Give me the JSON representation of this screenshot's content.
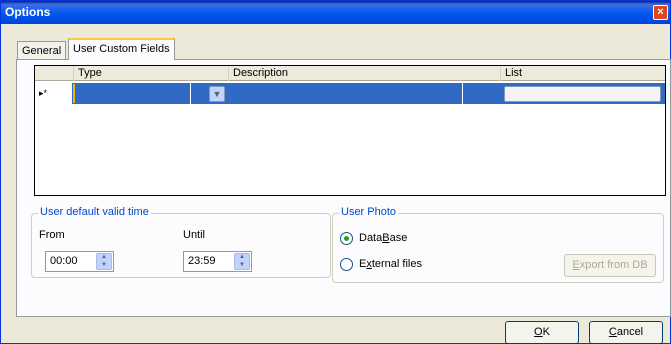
{
  "window": {
    "title": "Options",
    "close_glyph": "×"
  },
  "tabs": [
    {
      "label": "General",
      "active": false
    },
    {
      "label": "User Custom Fields",
      "active": true
    }
  ],
  "grid": {
    "columns": [
      "Type",
      "Description",
      "List"
    ],
    "row_indicator": "▸*",
    "rows": [
      {
        "type": "",
        "description": "",
        "list": ""
      }
    ]
  },
  "valid_time": {
    "title": "User default valid time",
    "from_label": "From",
    "until_label": "Until",
    "from_value": "00:00",
    "until_value": "23:59"
  },
  "photo": {
    "title": "User Photo",
    "options": [
      {
        "label_pre": "Data",
        "label_u": "B",
        "label_post": "ase",
        "checked": true
      },
      {
        "label_pre": "E",
        "label_u": "x",
        "label_post": "ternal files",
        "checked": false
      }
    ],
    "export_button": {
      "label_pre": "",
      "label_u": "E",
      "label_post": "xport from DB",
      "enabled": false
    }
  },
  "buttons": {
    "ok": {
      "label_u": "O",
      "label_post": "K"
    },
    "cancel": {
      "label_u": "C",
      "label_post": "ancel"
    }
  },
  "colors": {
    "title_bar": "#0058ee",
    "selection": "#316ac5",
    "group_title": "#0046d5"
  }
}
